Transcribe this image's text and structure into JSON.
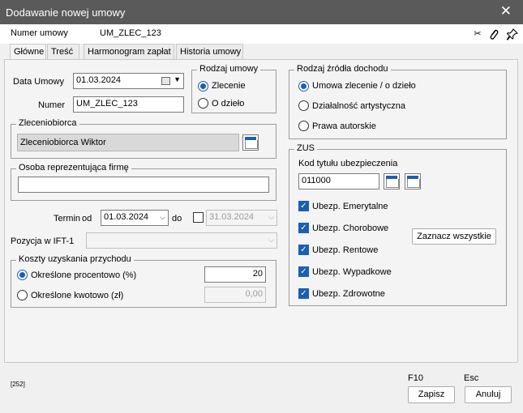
{
  "window": {
    "title": "Dodawanie nowej umowy",
    "close": "✕"
  },
  "header": {
    "label": "Numer umowy",
    "value": "UM_ZLEC_123"
  },
  "tabs": [
    "Główne",
    "Treść",
    "Harmonogram zapłat",
    "Historia umowy"
  ],
  "basic": {
    "date_label": "Data Umowy",
    "date_value": "01.03.2024",
    "number_label": "Numer",
    "number_value": "UM_ZLEC_123"
  },
  "contract_type": {
    "title": "Rodzaj umowy",
    "options": [
      "Zlecenie",
      "O dzieło"
    ]
  },
  "income_source": {
    "title": "Rodzaj źródła dochodu",
    "options": [
      "Umowa zlecenie / o dzieło",
      "Działalność artystyczna",
      "Prawa autorskie"
    ]
  },
  "contractor": {
    "title": "Zleceniobiorca",
    "value": "Zleceniobiorca Wiktor"
  },
  "representative": {
    "title": "Osoba reprezentująca firmę",
    "value": ""
  },
  "term": {
    "label": "Termin",
    "from_label": "od",
    "from_value": "01.03.2024",
    "to_label": "do",
    "to_value": "31.03.2024"
  },
  "ift": {
    "label": "Pozycja w IFT-1",
    "value": ""
  },
  "costs": {
    "title": "Koszty uzyskania przychodu",
    "percent_label": "Określone procentowo (%)",
    "percent_value": "20",
    "amount_label": "Określone kwotowo (zł)",
    "amount_value": "0,00"
  },
  "zus": {
    "title": "ZUS",
    "code_label": "Kod tytułu ubezpieczenia",
    "code_value": "011000",
    "items": [
      "Ubezp. Emerytalne",
      "Ubezp. Chorobowe",
      "Ubezp. Rentowe",
      "Ubezp. Wypadkowe",
      "Ubezp. Zdrowotne"
    ],
    "select_all": "Zaznacz wszystkie"
  },
  "footer": {
    "code": "[252]",
    "save_key": "F10",
    "save": "Zapisz",
    "cancel_key": "Esc",
    "cancel": "Anuluj"
  }
}
